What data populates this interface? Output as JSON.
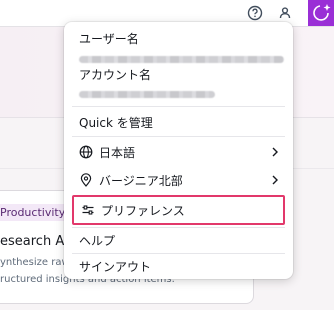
{
  "topbar": {
    "help_icon": "help-circle-icon",
    "user_icon": "user-icon",
    "assistant_icon": "sparkle-icon",
    "accent": "#9a2fd6"
  },
  "background": {
    "card": {
      "tag": "Productivity",
      "title": "esearch An",
      "desc_line1": "ynthesize raw",
      "desc_line2": "ructured insights and action items."
    }
  },
  "menu": {
    "username_label": "ユーザー名",
    "account_label": "アカウント名",
    "items": [
      {
        "label": "Quick を管理",
        "icon": ""
      },
      {
        "label": "日本語",
        "icon": "globe-icon",
        "submenu": true
      },
      {
        "label": "バージニア北部",
        "icon": "location-pin-icon",
        "submenu": true
      },
      {
        "label": "プリファレンス",
        "icon": "sliders-icon",
        "highlighted": true
      },
      {
        "label": "ヘルプ",
        "icon": ""
      },
      {
        "label": "サインアウト",
        "icon": ""
      }
    ],
    "highlight_color": "#e2386b"
  }
}
